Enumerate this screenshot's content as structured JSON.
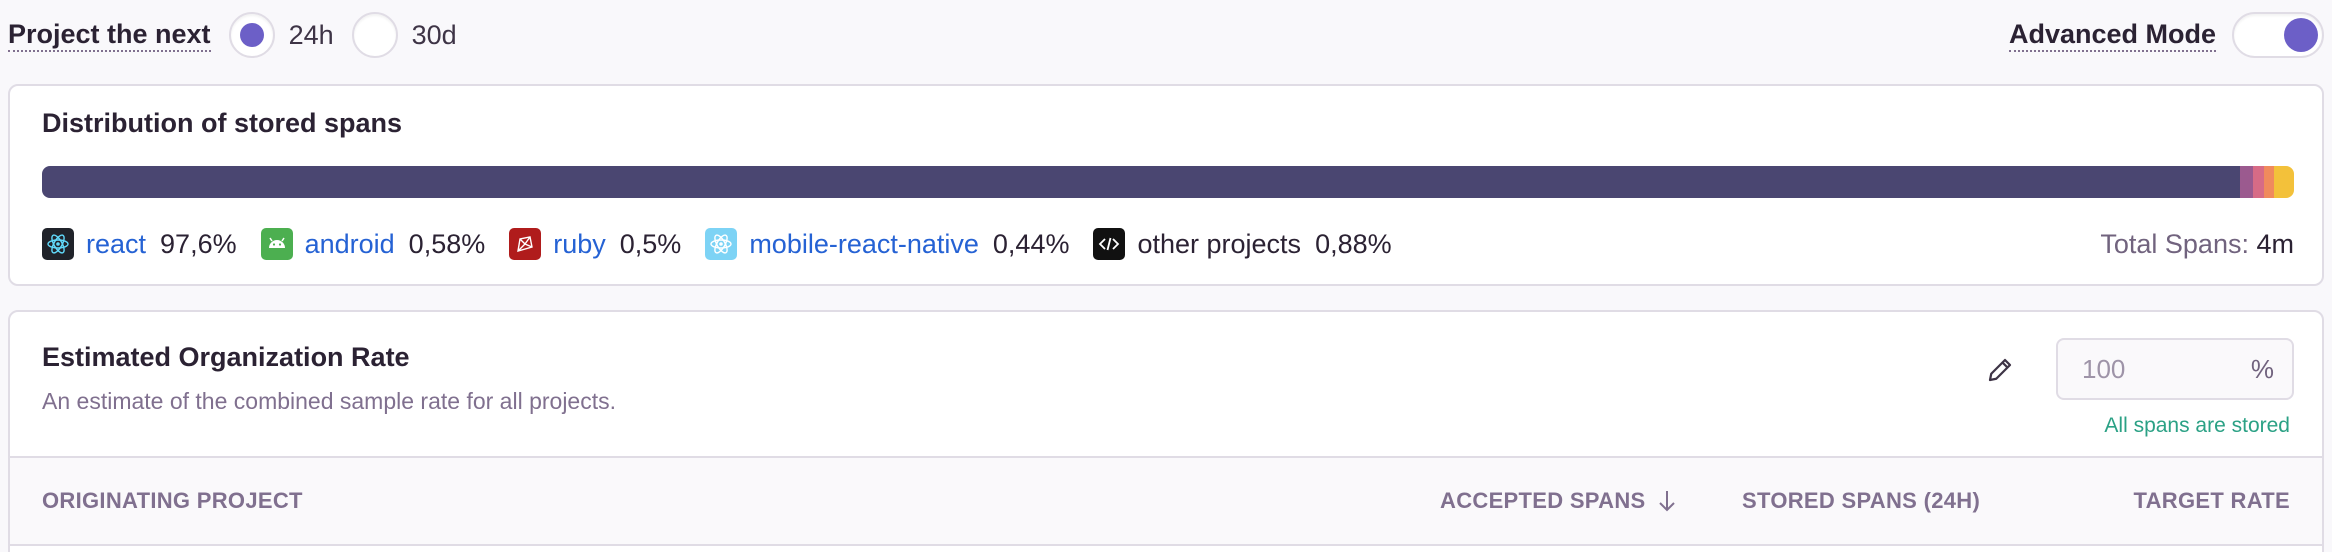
{
  "header": {
    "project_label": "Project the next",
    "period_options": [
      {
        "label": "24h",
        "selected": true
      },
      {
        "label": "30d",
        "selected": false
      }
    ],
    "advanced_mode_label": "Advanced Mode",
    "advanced_mode_on": true
  },
  "distribution": {
    "title": "Distribution of stored spans",
    "segments": [
      {
        "name": "react",
        "percent": 97.6,
        "color": "#4a4671"
      },
      {
        "name": "android",
        "percent": 0.58,
        "color": "#9b5a8f"
      },
      {
        "name": "ruby",
        "percent": 0.5,
        "color": "#d76b86"
      },
      {
        "name": "mobile-react-native",
        "percent": 0.44,
        "color": "#f08a5d"
      },
      {
        "name": "other projects",
        "percent": 0.88,
        "color": "#f3c13a"
      }
    ],
    "legend": [
      {
        "name": "react",
        "percent": "97,6%",
        "icon": "react-icon"
      },
      {
        "name": "android",
        "percent": "0,58%",
        "icon": "android-icon"
      },
      {
        "name": "ruby",
        "percent": "0,5%",
        "icon": "ruby-icon"
      },
      {
        "name": "mobile-react-native",
        "percent": "0,44%",
        "icon": "react-native-icon"
      },
      {
        "name": "other projects",
        "percent": "0,88%",
        "icon": "code-icon"
      }
    ],
    "total_label": "Total Spans:",
    "total_value": "4m"
  },
  "org_rate": {
    "title": "Estimated Organization Rate",
    "description": "An estimate of the combined sample rate for all projects.",
    "value": "100",
    "unit": "%",
    "status": "All spans are stored"
  },
  "table": {
    "columns": {
      "project": "ORIGINATING PROJECT",
      "accepted": "ACCEPTED SPANS",
      "stored": "STORED SPANS (24H)",
      "target": "TARGET RATE"
    }
  },
  "colors": {
    "accent": "#6c5fc7",
    "link": "#2562d4",
    "success": "#2ba185"
  }
}
